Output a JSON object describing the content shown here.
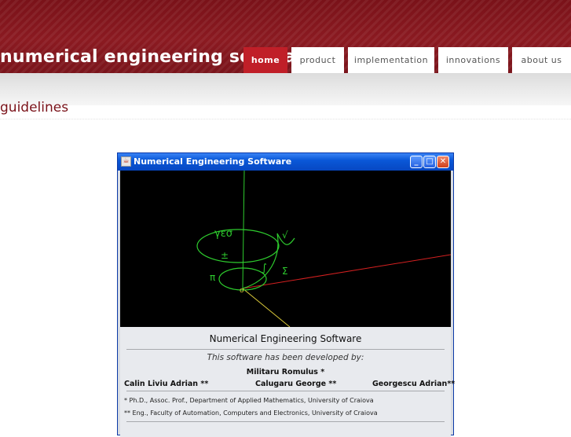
{
  "header": {
    "site_title": "numerical engineering software",
    "nav": [
      {
        "label": "home",
        "active": true
      },
      {
        "label": "product",
        "active": false
      },
      {
        "label": "implementation",
        "active": false
      },
      {
        "label": "innovations",
        "active": false
      },
      {
        "label": "about us",
        "active": false
      }
    ]
  },
  "section": {
    "title": "guidelines"
  },
  "window": {
    "title": "Numerical Engineering Software",
    "minimize": "_",
    "maximize": "□",
    "close": "✕",
    "canvas_symbols": {
      "top": "γεσ",
      "root": "√",
      "plusminus": "±",
      "integral": "∫",
      "sum": "Σ",
      "pi": "π",
      "origin": "o"
    },
    "heading": "Numerical Engineering Software",
    "developed_by": "This software has been developed by:",
    "authors": {
      "first": "Militaru Romulus *",
      "left": "Calin Liviu Adrian **",
      "center": "Calugaru George **",
      "right": "Georgescu Adrian**"
    },
    "notes": [
      "* Ph.D., Assoc. Prof., Department of Applied Mathematics, University of Craiova",
      "** Eng., Faculty of Automation, Computers and Electronics, University of Craiova"
    ]
  },
  "colors": {
    "brand": "#7a1219",
    "active_tab": "#c01f28",
    "curve_green": "#2ecc2e",
    "axis_red": "#d42020",
    "axis_yellow": "#d9c83a"
  }
}
